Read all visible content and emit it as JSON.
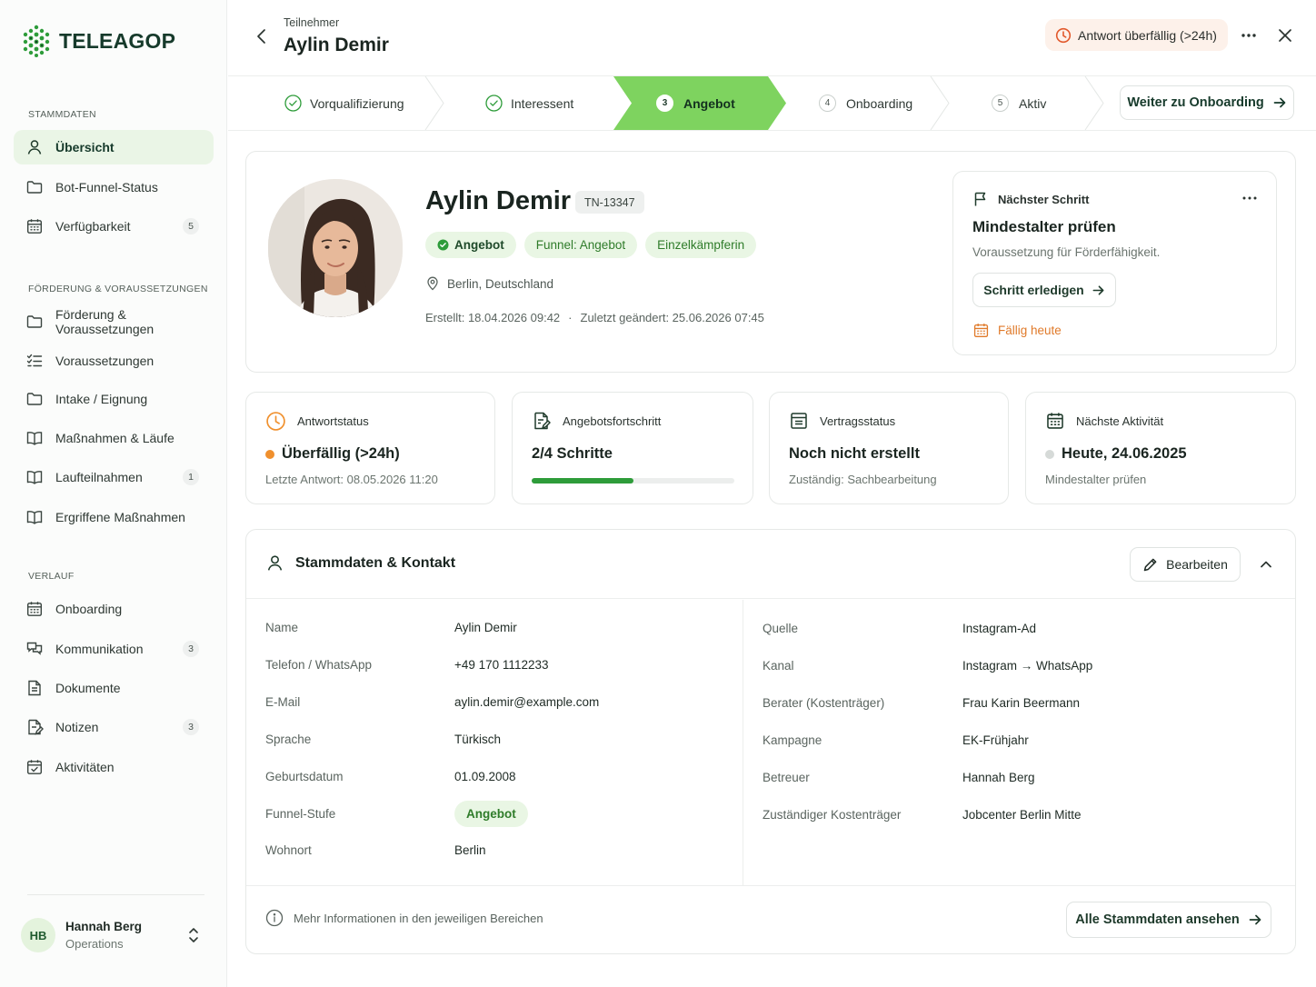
{
  "brand": {
    "name": "TELEAGOP",
    "accent": "#7ed35f",
    "dark_green": "#163a2b"
  },
  "sidebar": {
    "sections": [
      {
        "label": "STAMMDATEN"
      },
      {
        "label": "FÖRDERUNG & VORAUSSETZUNGEN"
      },
      {
        "label": "VERLAUF"
      }
    ],
    "items": [
      {
        "label": "Übersicht",
        "icon": "user-icon",
        "active": true
      },
      {
        "label": "Bot-Funnel-Status",
        "icon": "folder-icon"
      },
      {
        "label": "Verfügbarkeit",
        "icon": "calendar-icon",
        "count": "5"
      },
      {
        "label": "Förderung & Voraussetzungen",
        "icon": "folder-icon"
      },
      {
        "label": "Voraussetzungen",
        "icon": "checklist-icon"
      },
      {
        "label": "Intake / Eignung",
        "icon": "folder-icon"
      },
      {
        "label": "Maßnahmen & Läufe",
        "icon": "book-icon"
      },
      {
        "label": "Laufteilnahmen",
        "icon": "book-icon",
        "count": "1"
      },
      {
        "label": "Ergriffene Maßnahmen",
        "icon": "book-icon"
      },
      {
        "label": "Onboarding",
        "icon": "calendar-icon"
      },
      {
        "label": "Kommunikation",
        "icon": "chat-icon",
        "count": "3"
      },
      {
        "label": "Dokumente",
        "icon": "document-icon"
      },
      {
        "label": "Notizen",
        "icon": "note-icon",
        "count": "3"
      },
      {
        "label": "Aktivitäten",
        "icon": "calendar-icon"
      }
    ],
    "user": {
      "initials": "HB",
      "name": "Hannah Berg",
      "role": "Operations"
    }
  },
  "header": {
    "breadcrumb": "Teilnehmer",
    "title": "Aylin Demir",
    "overdue_label": "Antwort überfällig (>24h)"
  },
  "stepper": {
    "steps": [
      {
        "label": "Vorqualifizierung",
        "state": "done"
      },
      {
        "label": "Interessent",
        "state": "done"
      },
      {
        "label": "Angebot",
        "number": "3",
        "state": "active"
      },
      {
        "label": "Onboarding",
        "number": "4",
        "state": "todo"
      },
      {
        "label": "Aktiv",
        "number": "5",
        "state": "todo"
      }
    ],
    "next_button": "Weiter zu Onboarding"
  },
  "profile": {
    "name": "Aylin Demir",
    "id": "TN-13347",
    "tags": [
      "Angebot",
      "Funnel: Angebot",
      "Einzelkämpferin"
    ],
    "location": "Berlin, Deutschland",
    "created": "Erstellt: 18.04.2026 09:42",
    "separator": "·",
    "modified": "Zuletzt geändert: 25.06.2026 07:45"
  },
  "next_step": {
    "heading": "Nächster Schritt",
    "title": "Mindestalter prüfen",
    "description": "Voraussetzung für Förderfähigkeit.",
    "button": "Schritt erledigen",
    "due": "Fällig heute"
  },
  "stats": {
    "response": {
      "label": "Antwortstatus",
      "value": "Überfällig (>24h)",
      "sub": "Letzte Antwort: 08.05.2026 11:20",
      "dot_color": "#f0902d"
    },
    "offer": {
      "label": "Angebotsfortschritt",
      "value": "2/4 Schritte",
      "progress": 0.5
    },
    "contract": {
      "label": "Vertragsstatus",
      "value": "Noch nicht erstellt",
      "sub": "Zuständig: Sachbearbeitung"
    },
    "activity": {
      "label": "Nächste Aktivität",
      "value": "Heute, 24.06.2025",
      "sub": "Mindestalter prüfen",
      "dot_color": "#d6dad8"
    }
  },
  "master": {
    "title": "Stammdaten & Kontakt",
    "edit_button": "Bearbeiten",
    "left": [
      {
        "k": "Name",
        "v": "Aylin Demir"
      },
      {
        "k": "Telefon / WhatsApp",
        "v": "+49 170 1112233"
      },
      {
        "k": "E-Mail",
        "v": "aylin.demir@example.com"
      },
      {
        "k": "Sprache",
        "v": "Türkisch"
      },
      {
        "k": "Geburtsdatum",
        "v": "01.09.2008"
      },
      {
        "k": "Funnel-Stufe",
        "v": "Angebot"
      },
      {
        "k": "Wohnort",
        "v": "Berlin"
      }
    ],
    "right": [
      {
        "k": "Quelle",
        "v": "Instagram-Ad"
      },
      {
        "k": "Kanal",
        "v": "Instagram → WhatsApp"
      },
      {
        "k": "Berater (Kostenträger)",
        "v": "Frau Karin Beermann"
      },
      {
        "k": "Kampagne",
        "v": "EK-Frühjahr"
      },
      {
        "k": "Betreuer",
        "v": "Hannah Berg"
      },
      {
        "k": "Zuständiger Kostenträger",
        "v": "Jobcenter Berlin Mitte"
      }
    ],
    "footer_info": "Mehr Informationen in den jeweiligen Bereichen",
    "all_button": "Alle Stammdaten ansehen"
  }
}
